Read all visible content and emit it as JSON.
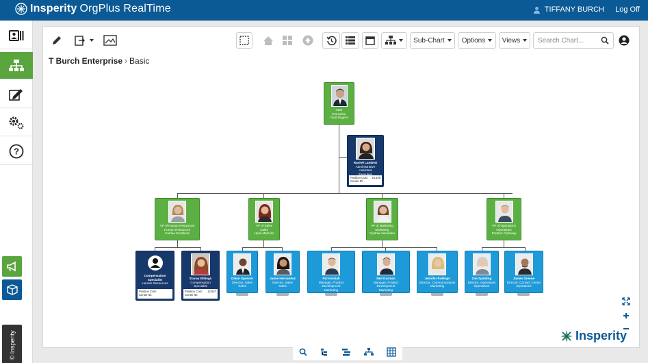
{
  "header": {
    "brand_main": "Insperity",
    "brand_sub": "OrgPlus RealTime",
    "user_name": "TIFFANY BURCH",
    "logoff_label": "Log Off"
  },
  "sidebar": {
    "items": [
      {
        "name": "profile-card-icon"
      },
      {
        "name": "org-chart-icon"
      },
      {
        "name": "edit-icon"
      },
      {
        "name": "settings-gears-icon"
      },
      {
        "name": "help-icon"
      }
    ],
    "vertical_label": "© Insperity"
  },
  "toolbar": {
    "subchart_label": "Sub-Chart",
    "options_label": "Options",
    "views_label": "Views",
    "search_placeholder": "Search Chart..."
  },
  "breadcrumb": {
    "root": "T Burch Enterprise",
    "separator": "›",
    "current": "Basic"
  },
  "colors": {
    "header": "#0b5a96",
    "executive": "#5cb043",
    "staff": "#17386b",
    "member": "#1e9ad8"
  },
  "org": {
    "ceo": {
      "title": "CEO",
      "dept": "Executive",
      "name": "Todd Rogers"
    },
    "assistant": {
      "name": "Rachel Lambert",
      "title": "Administrative Assistant",
      "dept": "Executive",
      "cost_label": "Position Cost:",
      "cost_value": "18,328",
      "center_label": "Center ID:",
      "center_value": ""
    },
    "vps": [
      {
        "title": "VP of Human Resources",
        "dept": "Human Resources",
        "name": "Karmie Smothers"
      },
      {
        "title": "VP of Sales",
        "dept": "Sales",
        "name": "Hyde Malcolm"
      },
      {
        "title": "VP of Marketing",
        "dept": "Marketing",
        "name": "Cynthia Alexander"
      },
      {
        "title": "VP of Operations",
        "dept": "Operations",
        "name": "Preston Calloway"
      }
    ],
    "staff": [
      {
        "name": "Compensation Specialist",
        "title": "Human Resources",
        "dept": "",
        "cost_label": "Position Cost:",
        "cost_value": "",
        "center_label": "Center ID:",
        "center_value": ""
      },
      {
        "name": "Stacey Billings",
        "title": "Compensation Specialist",
        "dept": "Human Resources",
        "cost_label": "Position Cost:",
        "cost_value": "12,947",
        "center_label": "Center ID:",
        "center_value": ""
      },
      {
        "name": "Glenn Spencer",
        "title": "Director, Sales",
        "dept": "Sales"
      },
      {
        "name": "Jamie Hernandez",
        "title": "Director, Sales",
        "dept": "Sales"
      },
      {
        "name": "Pat Kendall",
        "title": "Manager, Product Development",
        "dept": "Marketing"
      },
      {
        "name": "Neil Gorman",
        "title": "Manager, Product Development",
        "dept": "Marketing"
      },
      {
        "name": "Jennifer Rollings",
        "title": "Director, Communications",
        "dept": "Marketing"
      },
      {
        "name": "Zoe Spalding",
        "title": "Director, Operations",
        "dept": "Operations"
      },
      {
        "name": "James Greene",
        "title": "Director, Contact Center",
        "dept": "Operations"
      }
    ]
  },
  "watermark": "Insperity"
}
